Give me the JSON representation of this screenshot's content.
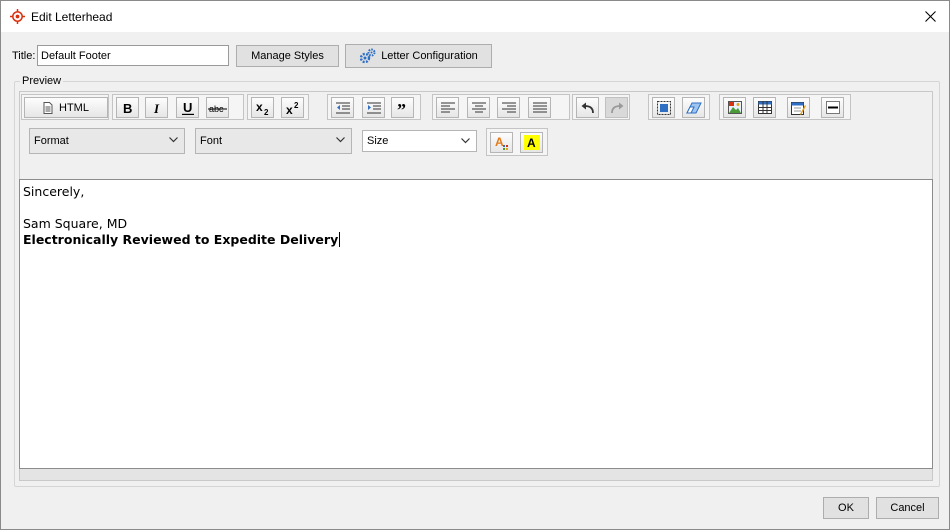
{
  "window": {
    "title": "Edit Letterhead",
    "icon": "target-icon"
  },
  "header": {
    "title_label": "Title:",
    "title_value": "Default Footer",
    "manage_styles_label": "Manage Styles",
    "letter_configuration_label": "Letter Configuration"
  },
  "preview": {
    "legend": "Preview"
  },
  "toolbar": {
    "html_label": "HTML",
    "buttons": [
      "bold-icon",
      "italic-icon",
      "underline-icon",
      "strikethrough-icon",
      "subscript-icon",
      "superscript-icon",
      "outdent-icon",
      "indent-icon",
      "blockquote-icon",
      "align-left-icon",
      "align-center-icon",
      "align-right-icon",
      "align-justify-icon",
      "undo-icon",
      "redo-icon",
      "select-all-icon",
      "eraser-icon",
      "image-icon",
      "table-icon",
      "calendar-icon",
      "horizontal-rule-icon",
      "text-color-icon",
      "highlight-color-icon"
    ],
    "format_label": "Format",
    "font_label": "Font",
    "size_label": "Size",
    "text_color_glyph": "A",
    "highlight_glyph": "A"
  },
  "editor": {
    "lines": [
      "Sincerely,",
      "",
      "Sam Square, MD",
      "Electronically Reviewed to Expedite Delivery"
    ]
  },
  "footer": {
    "ok_label": "OK",
    "cancel_label": "Cancel"
  },
  "colors": {
    "accent": "#d9310f",
    "gear": "#2e6fc4",
    "highlight": "#ffff00"
  }
}
